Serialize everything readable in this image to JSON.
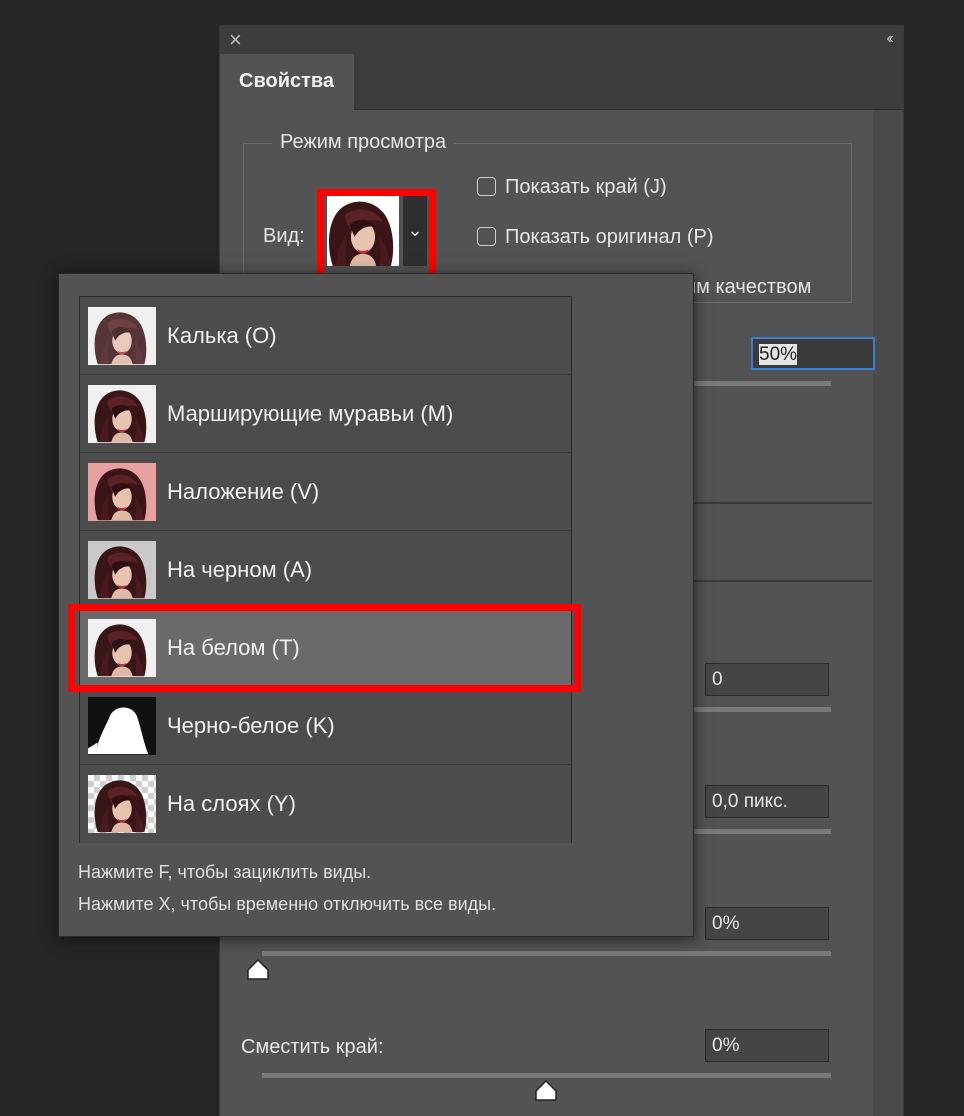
{
  "panel": {
    "tab_label": "Свойства",
    "group_title": "Режим просмотра",
    "view_label": "Вид:",
    "show_edge_label": "Показать край (J)",
    "show_original_label": "Показать оригинал (P)",
    "quality_label_visible": "им качеством",
    "opacity_value": "50%",
    "field_smooth_value": "0",
    "field_feather_value": "0,0 пикс.",
    "field_contrast_value": "0%",
    "offset_edge_label": "Сместить край:",
    "field_offset_value": "0%"
  },
  "dropdown": {
    "items": [
      {
        "label": "Калька (O)",
        "icon": "portrait-onion-skin-icon"
      },
      {
        "label": "Марширующие муравьи (M)",
        "icon": "portrait-marching-ants-icon"
      },
      {
        "label": "Наложение (V)",
        "icon": "portrait-overlay-icon"
      },
      {
        "label": "На черном (A)",
        "icon": "portrait-on-black-icon"
      },
      {
        "label": "На белом (T)",
        "icon": "portrait-on-white-icon"
      },
      {
        "label": "Черно-белое (K)",
        "icon": "mask-black-white-icon"
      },
      {
        "label": "На слоях (Y)",
        "icon": "portrait-on-layers-icon"
      }
    ],
    "selected_index": 4,
    "hint_cycle": "Нажмите F, чтобы зациклить виды.",
    "hint_disable": "Нажмите X, чтобы временно отключить все виды."
  },
  "colors": {
    "highlight": "#fe0000",
    "panel_bg": "#535353",
    "focus": "#3b7bd0"
  }
}
